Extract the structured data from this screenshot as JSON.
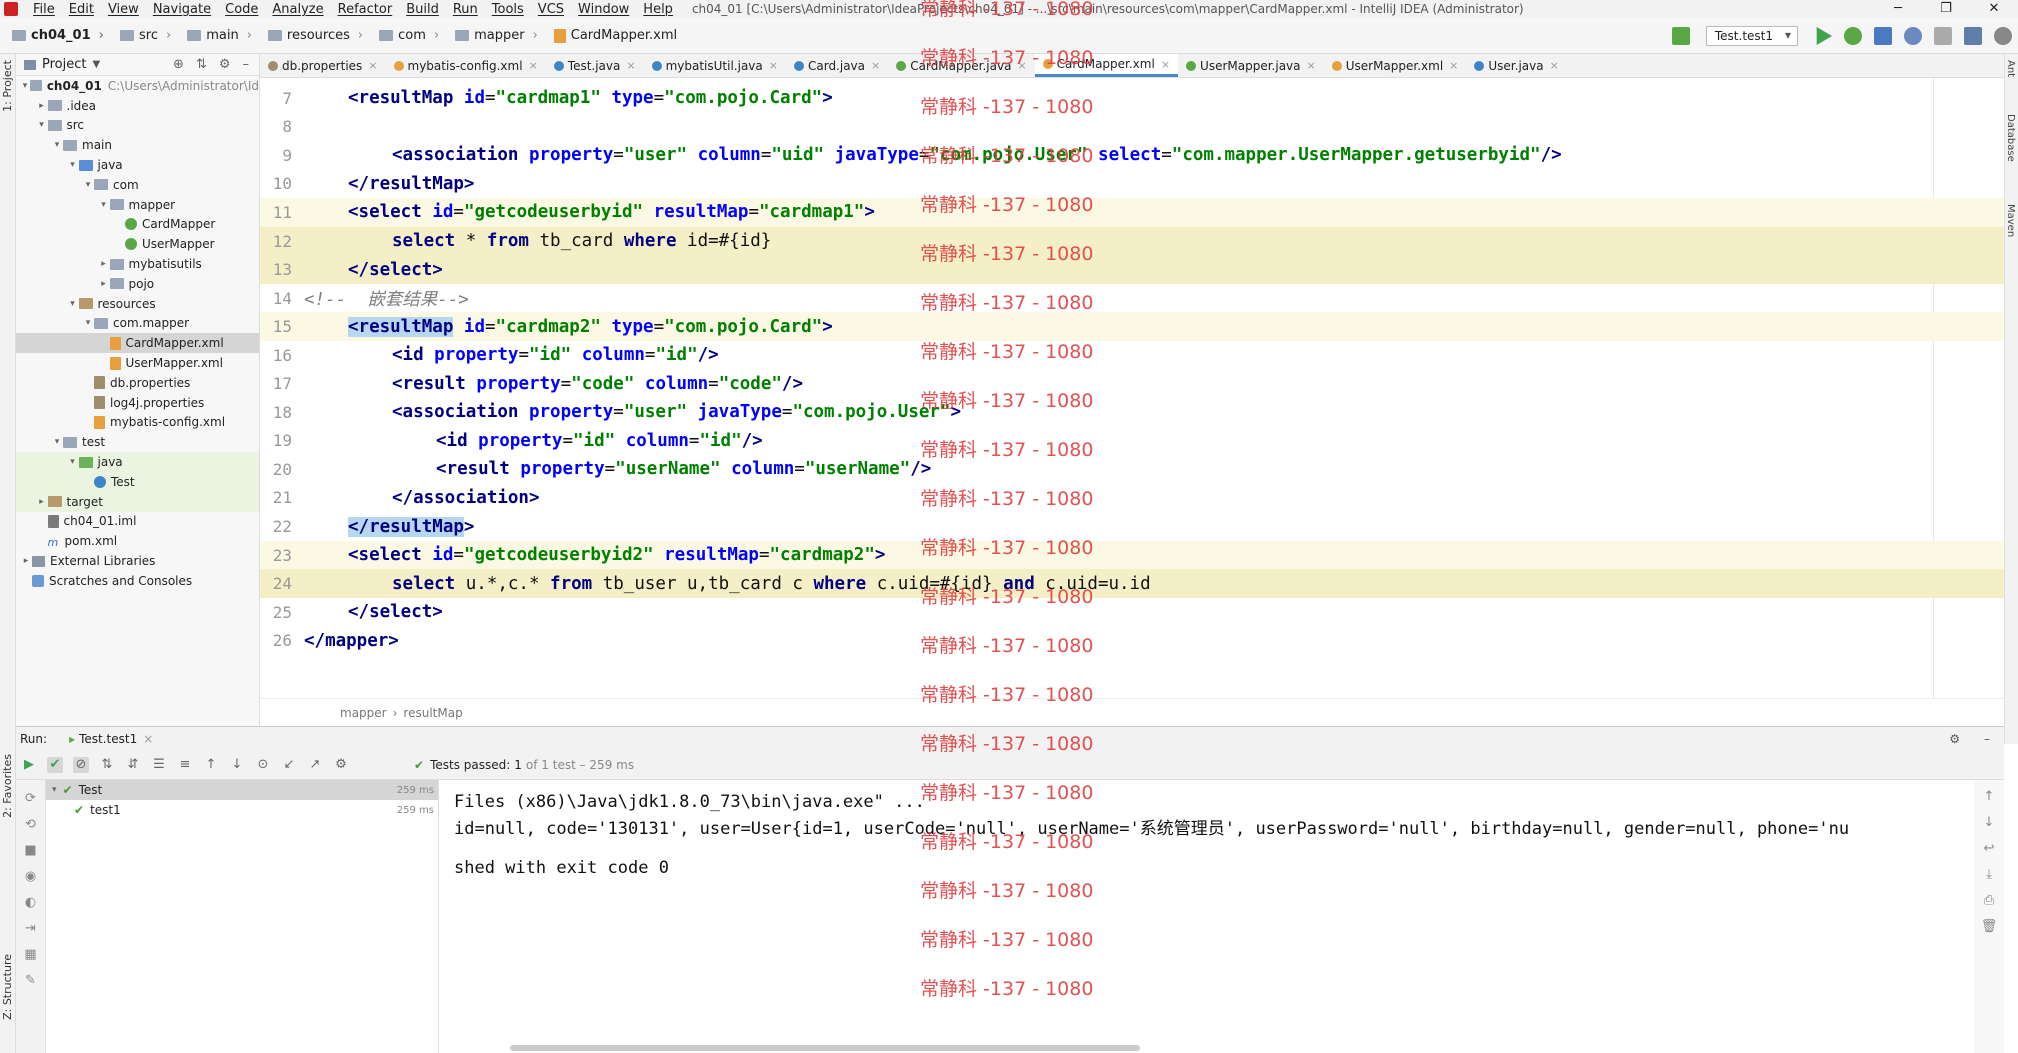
{
  "menubar": {
    "items": [
      "File",
      "Edit",
      "View",
      "Navigate",
      "Code",
      "Analyze",
      "Refactor",
      "Build",
      "Run",
      "Tools",
      "VCS",
      "Window",
      "Help"
    ],
    "window_title": "ch04_01 [C:\\Users\\Administrator\\IdeaProjects\\ch04_01] - ...\\src\\main\\resources\\com\\mapper\\CardMapper.xml - IntelliJ IDEA (Administrator)"
  },
  "navbar": {
    "crumbs": [
      "ch04_01",
      "src",
      "main",
      "resources",
      "com",
      "mapper",
      "CardMapper.xml"
    ],
    "run_config": "Test.test1"
  },
  "project": {
    "title": "Project",
    "tree": [
      {
        "label": "ch04_01",
        "extra": "C:\\Users\\Administrator\\Id",
        "icon": "folder",
        "indent": 0,
        "arrow": "▾",
        "bold": true
      },
      {
        "label": ".idea",
        "icon": "folder",
        "indent": 1,
        "arrow": "▸"
      },
      {
        "label": "src",
        "icon": "folder",
        "indent": 1,
        "arrow": "▾"
      },
      {
        "label": "main",
        "icon": "folder",
        "indent": 2,
        "arrow": "▾"
      },
      {
        "label": "java",
        "icon": "srcfolder",
        "indent": 3,
        "arrow": "▾"
      },
      {
        "label": "com",
        "icon": "pkg",
        "indent": 4,
        "arrow": "▾"
      },
      {
        "label": "mapper",
        "icon": "pkg",
        "indent": 5,
        "arrow": "▾"
      },
      {
        "label": "CardMapper",
        "icon": "iface",
        "indent": 6,
        "arrow": ""
      },
      {
        "label": "UserMapper",
        "icon": "iface",
        "indent": 6,
        "arrow": ""
      },
      {
        "label": "mybatisutils",
        "icon": "pkg",
        "indent": 5,
        "arrow": "▸"
      },
      {
        "label": "pojo",
        "icon": "pkg",
        "indent": 5,
        "arrow": "▸"
      },
      {
        "label": "resources",
        "icon": "resfolder",
        "indent": 3,
        "arrow": "▾"
      },
      {
        "label": "com.mapper",
        "icon": "pkg",
        "indent": 4,
        "arrow": "▾"
      },
      {
        "label": "CardMapper.xml",
        "icon": "xml",
        "indent": 5,
        "arrow": "",
        "selected": true
      },
      {
        "label": "UserMapper.xml",
        "icon": "xml",
        "indent": 5,
        "arrow": ""
      },
      {
        "label": "db.properties",
        "icon": "props",
        "indent": 4,
        "arrow": ""
      },
      {
        "label": "log4j.properties",
        "icon": "props",
        "indent": 4,
        "arrow": ""
      },
      {
        "label": "mybatis-config.xml",
        "icon": "xml",
        "indent": 4,
        "arrow": ""
      },
      {
        "label": "test",
        "icon": "folder",
        "indent": 2,
        "arrow": "▾"
      },
      {
        "label": "java",
        "icon": "testfolder",
        "indent": 3,
        "arrow": "▾",
        "green": true
      },
      {
        "label": "Test",
        "icon": "cls",
        "indent": 4,
        "arrow": "",
        "green": true
      },
      {
        "label": "target",
        "icon": "resfolder",
        "indent": 1,
        "arrow": "▸",
        "green": true
      },
      {
        "label": "ch04_01.iml",
        "icon": "iml",
        "indent": 1,
        "arrow": ""
      },
      {
        "label": "pom.xml",
        "icon": "mvn",
        "indent": 1,
        "arrow": ""
      },
      {
        "label": "External Libraries",
        "icon": "lib",
        "indent": 0,
        "arrow": "▸"
      },
      {
        "label": "Scratches and Consoles",
        "icon": "scratch",
        "indent": 0,
        "arrow": ""
      }
    ]
  },
  "tabs": [
    {
      "label": "db.properties",
      "color": "#a08d6e"
    },
    {
      "label": "mybatis-config.xml",
      "color": "#e8a03e"
    },
    {
      "label": "Test.java",
      "color": "#3e86c8"
    },
    {
      "label": "mybatisUtil.java",
      "color": "#3e86c8"
    },
    {
      "label": "Card.java",
      "color": "#3e86c8"
    },
    {
      "label": "CardMapper.java",
      "color": "#5aa845"
    },
    {
      "label": "CardMapper.xml",
      "color": "#e8a03e",
      "active": true
    },
    {
      "label": "UserMapper.java",
      "color": "#5aa845"
    },
    {
      "label": "UserMapper.xml",
      "color": "#e8a03e"
    },
    {
      "label": "User.java",
      "color": "#3e86c8"
    }
  ],
  "editor": {
    "lines": [
      {
        "n": "7",
        "indent": 1
      },
      {
        "n": "8",
        "indent": 0
      },
      {
        "n": "9",
        "indent": 2
      },
      {
        "n": "10",
        "indent": 1
      },
      {
        "n": "11",
        "indent": 1,
        "hl": "hl"
      },
      {
        "n": "12",
        "indent": 2,
        "hl": "hlb"
      },
      {
        "n": "13",
        "indent": 1,
        "hl": "hlb"
      },
      {
        "n": "14",
        "indent": 0
      },
      {
        "n": "15",
        "indent": 1,
        "hl": "hl"
      },
      {
        "n": "16",
        "indent": 2
      },
      {
        "n": "17",
        "indent": 2
      },
      {
        "n": "18",
        "indent": 2
      },
      {
        "n": "19",
        "indent": 3
      },
      {
        "n": "20",
        "indent": 3
      },
      {
        "n": "21",
        "indent": 2
      },
      {
        "n": "22",
        "indent": 1
      },
      {
        "n": "23",
        "indent": 1,
        "hl": "hl"
      },
      {
        "n": "24",
        "indent": 2,
        "hl": "hlb"
      },
      {
        "n": "25",
        "indent": 1
      },
      {
        "n": "26",
        "indent": 0
      }
    ],
    "code": [
      "<resultMap id=\"cardmap1\" type=\"com.pojo.Card\">",
      "",
      "<association property=\"user\" column=\"uid\" javaType=\"com.pojo.User\" select=\"com.mapper.UserMapper.getuserbyid\"/>",
      "</resultMap>",
      "<select id=\"getcodeuserbyid\" resultMap=\"cardmap1\">",
      "select * from tb_card where id=#{id}",
      "</select>",
      "<!--  嵌套结果-->",
      "<resultMap id=\"cardmap2\" type=\"com.pojo.Card\">",
      "<id property=\"id\" column=\"id\"/>",
      "<result property=\"code\" column=\"code\"/>",
      "<association property=\"user\" javaType=\"com.pojo.User\">",
      "<id property=\"id\" column=\"id\"/>",
      "<result property=\"userName\" column=\"userName\"/>",
      "</association>",
      "</resultMap>",
      "<select id=\"getcodeuserbyid2\" resultMap=\"cardmap2\">",
      "select u.*,c.* from tb_user u,tb_card c where c.uid=#{id} and c.uid=u.id",
      "</select>",
      "</mapper>"
    ],
    "breadcrumb": [
      "mapper",
      "resultMap"
    ]
  },
  "run": {
    "label": "Run:",
    "tab": "Test.test1",
    "status_prefix": "Tests passed:",
    "status_count": "1",
    "status_suffix": "of 1 test – 259 ms",
    "tree": [
      {
        "label": "Test",
        "ms": "259 ms",
        "indent": 0,
        "selected": true
      },
      {
        "label": "test1",
        "ms": "259 ms",
        "indent": 1
      }
    ],
    "console": [
      "Files (x86)\\Java\\jdk1.8.0_73\\bin\\java.exe\" ...",
      "id=null, code='130131', user=User{id=1, userCode='null', userName='系统管理员', userPassword='null', birthday=null, gender=null, phone='nu",
      "",
      "shed with exit code 0"
    ]
  },
  "left_labels": [
    "1: Project",
    "2: Favorites",
    "Z: Structure"
  ],
  "right_labels": [
    "Ant",
    "Database",
    "Maven"
  ],
  "watermark": "常静科 -137 - 1080"
}
